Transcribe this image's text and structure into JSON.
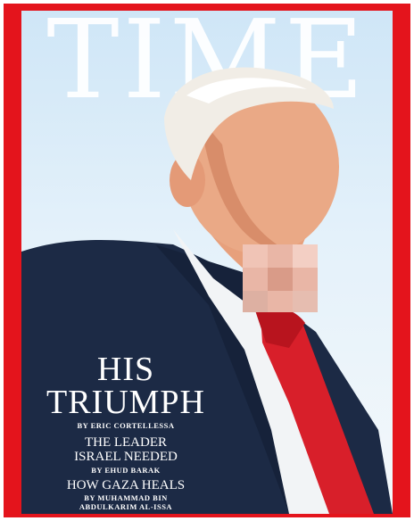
{
  "cover": {
    "masthead": "TIME",
    "headline": {
      "line1": "HIS",
      "line2": "TRIUMPH"
    },
    "headline_byline": "by ERIC CORTELLESSA",
    "story2": {
      "line1": "THE LEADER",
      "line2": "ISRAEL NEEDED",
      "byline": "by EHUD BARAK"
    },
    "story3": {
      "line1": "HOW GAZA HEALS",
      "byline_line1": "by MUHAMMAD BIN",
      "byline_line2": "ABDULKARIM AL-ISSA"
    }
  },
  "colors": {
    "frame_red": "#e4141c",
    "suit_navy": "#1c2a45",
    "tie_red": "#d81f2a",
    "sky": "#d6eaf8"
  }
}
